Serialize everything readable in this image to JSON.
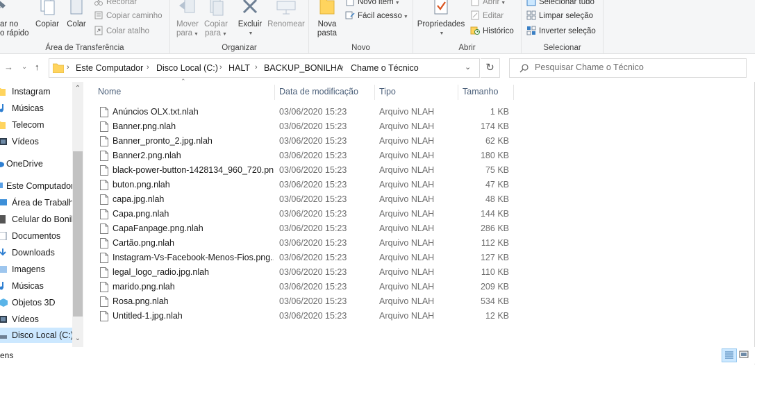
{
  "ribbon": {
    "clipboard": {
      "pin_label_1": "ar no",
      "pin_label_2": "o rápido",
      "copy": "Copiar",
      "paste": "Colar",
      "cut": "Recortar",
      "copy_path": "Copiar caminho",
      "paste_shortcut": "Colar atalho",
      "group": "Área de Transferência"
    },
    "organize": {
      "move_to_1": "Mover",
      "move_to_2": "para",
      "copy_to_1": "Copiar",
      "copy_to_2": "para",
      "delete": "Excluir",
      "rename": "Renomear",
      "group": "Organizar"
    },
    "new": {
      "new_folder_1": "Nova",
      "new_folder_2": "pasta",
      "new_item": "Novo item",
      "easy_access": "Fácil acesso",
      "group": "Novo"
    },
    "open": {
      "properties": "Propriedades",
      "open": "Abrir",
      "edit": "Editar",
      "history": "Histórico",
      "group": "Abrir"
    },
    "select": {
      "select_all": "Selecionar tudo",
      "select_none": "Limpar seleção",
      "invert": "Inverter seleção",
      "group": "Selecionar"
    }
  },
  "address": {
    "crumbs": [
      "Este Computador",
      "Disco Local (C:)",
      "HALT",
      "BACKUP_BONILHA",
      "Chame o Técnico"
    ]
  },
  "search": {
    "placeholder": "Pesquisar Chame o Técnico"
  },
  "sidebar": {
    "items": [
      {
        "label": "Instagram",
        "icon": "folder-icon"
      },
      {
        "label": "Músicas",
        "icon": "music-icon"
      },
      {
        "label": "Telecom",
        "icon": "folder-icon"
      },
      {
        "label": "Vídeos",
        "icon": "video-icon"
      },
      {
        "label": "OneDrive",
        "icon": "cloud-icon"
      },
      {
        "label": "Este Computador",
        "icon": "computer-icon"
      },
      {
        "label": "Área de Trabalho",
        "icon": "desktop-icon"
      },
      {
        "label": "Celular do Bonilha",
        "icon": "phone-icon"
      },
      {
        "label": "Documentos",
        "icon": "documents-icon"
      },
      {
        "label": "Downloads",
        "icon": "download-icon"
      },
      {
        "label": "Imagens",
        "icon": "pictures-icon"
      },
      {
        "label": "Músicas",
        "icon": "music-icon"
      },
      {
        "label": "Objetos 3D",
        "icon": "cube-icon"
      },
      {
        "label": "Vídeos",
        "icon": "video-icon"
      },
      {
        "label": "Disco Local (C:)",
        "icon": "drive-icon"
      }
    ]
  },
  "columns": {
    "name": "Nome",
    "date": "Data de modificação",
    "type": "Tipo",
    "size": "Tamanho"
  },
  "files": [
    {
      "name": "Anúncios OLX.txt.nlah",
      "date": "03/06/2020 15:23",
      "type": "Arquivo NLAH",
      "size": "1 KB"
    },
    {
      "name": "Banner.png.nlah",
      "date": "03/06/2020 15:23",
      "type": "Arquivo NLAH",
      "size": "174 KB"
    },
    {
      "name": "Banner_pronto_2.jpg.nlah",
      "date": "03/06/2020 15:23",
      "type": "Arquivo NLAH",
      "size": "62 KB"
    },
    {
      "name": "Banner2.png.nlah",
      "date": "03/06/2020 15:23",
      "type": "Arquivo NLAH",
      "size": "180 KB"
    },
    {
      "name": "black-power-button-1428134_960_720.pn...",
      "date": "03/06/2020 15:23",
      "type": "Arquivo NLAH",
      "size": "75 KB"
    },
    {
      "name": "buton.png.nlah",
      "date": "03/06/2020 15:23",
      "type": "Arquivo NLAH",
      "size": "47 KB"
    },
    {
      "name": "capa.jpg.nlah",
      "date": "03/06/2020 15:23",
      "type": "Arquivo NLAH",
      "size": "48 KB"
    },
    {
      "name": "Capa.png.nlah",
      "date": "03/06/2020 15:23",
      "type": "Arquivo NLAH",
      "size": "144 KB"
    },
    {
      "name": "CapaFanpage.png.nlah",
      "date": "03/06/2020 15:23",
      "type": "Arquivo NLAH",
      "size": "286 KB"
    },
    {
      "name": "Cartão.png.nlah",
      "date": "03/06/2020 15:23",
      "type": "Arquivo NLAH",
      "size": "112 KB"
    },
    {
      "name": "Instagram-Vs-Facebook-Menos-Fios.png...",
      "date": "03/06/2020 15:23",
      "type": "Arquivo NLAH",
      "size": "127 KB"
    },
    {
      "name": "legal_logo_radio.jpg.nlah",
      "date": "03/06/2020 15:23",
      "type": "Arquivo NLAH",
      "size": "110 KB"
    },
    {
      "name": "marido.png.nlah",
      "date": "03/06/2020 15:23",
      "type": "Arquivo NLAH",
      "size": "209 KB"
    },
    {
      "name": "Rosa.png.nlah",
      "date": "03/06/2020 15:23",
      "type": "Arquivo NLAH",
      "size": "534 KB"
    },
    {
      "name": "Untitled-1.jpg.nlah",
      "date": "03/06/2020 15:23",
      "type": "Arquivo NLAH",
      "size": "12 KB"
    }
  ],
  "status": {
    "text": "ens"
  },
  "colors": {
    "accent": "#0078d7",
    "selection": "#cce8ff",
    "folder": "#ffd45e",
    "header_text": "#4c607a"
  }
}
